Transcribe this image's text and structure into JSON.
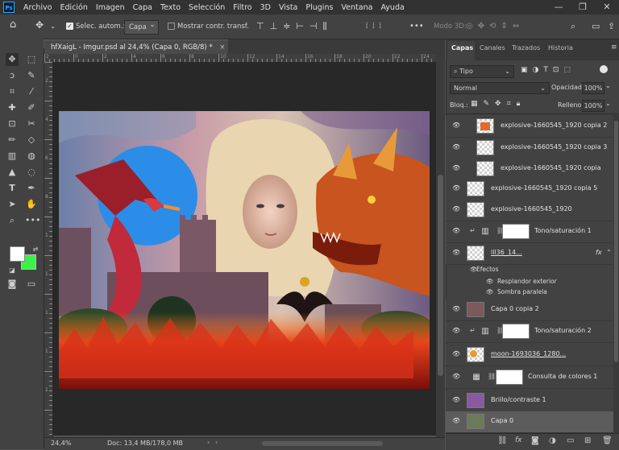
{
  "menu": [
    "Archivo",
    "Edición",
    "Imagen",
    "Capa",
    "Texto",
    "Selección",
    "Filtro",
    "3D",
    "Vista",
    "Plugins",
    "Ventana",
    "Ayuda"
  ],
  "window_controls": {
    "minimize": "—",
    "maximize": "❐",
    "close": "✕"
  },
  "options": {
    "autoselect_label": "Selec. autom.:",
    "autoselect_value": "Capa",
    "transform_label": "Mostrar contr. transf.",
    "mode3d_label": "Modo 3D:",
    "more": "•••"
  },
  "document": {
    "tab_title": "hfXaigL - Imgur.psd al 24,4% (Capa 0, RGB/8) *",
    "close": "×",
    "zoom": "24,4%",
    "doc_info": "Doc: 13,4 MB/178,0 MB"
  },
  "panel_tabs": [
    "Capas",
    "Canales",
    "Trazados",
    "Historia"
  ],
  "layers_panel": {
    "filter_label": "Tipo",
    "blend_mode": "Normal",
    "opacity_label": "Opacidad:",
    "opacity_value": "100%",
    "lock_label": "Bloq.:",
    "fill_label": "Relleno:",
    "fill_value": "100%"
  },
  "layers": [
    {
      "name": "explosive-1660545_1920 copia 2",
      "type": "explosion",
      "visible": true
    },
    {
      "name": "explosive-1660545_1920 copia 3",
      "type": "transparent",
      "visible": true
    },
    {
      "name": "explosive-1660545_1920 copia",
      "type": "transparent",
      "visible": true
    },
    {
      "name": "explosive-1660545_1920 copia 5",
      "type": "transparent",
      "visible": true
    },
    {
      "name": "explosive-1660545_1920",
      "type": "transparent",
      "visible": true
    },
    {
      "name": "Tono/saturación 1",
      "type": "adjustment",
      "visible": true
    },
    {
      "name": "lll36_14...",
      "type": "transparent",
      "visible": true,
      "fx": "fx"
    },
    {
      "name": "Capa 0 copia 2",
      "type": "photo",
      "visible": true
    },
    {
      "name": "Tono/saturación 2",
      "type": "adjustment",
      "visible": true
    },
    {
      "name": "moon-1693036_1280...",
      "type": "moon",
      "visible": true
    },
    {
      "name": "Consulta de colores 1",
      "type": "lookup",
      "visible": true
    },
    {
      "name": "Brillo/contraste 1",
      "type": "photo",
      "visible": true
    },
    {
      "name": "Capa 0",
      "type": "photo",
      "visible": true,
      "selected": true
    }
  ],
  "effects": {
    "title": "Efectos",
    "items": [
      "Resplandor exterior",
      "Sombra paralela"
    ]
  },
  "ruler_h": [
    "2",
    "0",
    "2",
    "4",
    "6",
    "8",
    "10",
    "12",
    "14",
    "16",
    "18",
    "20",
    "22",
    "24"
  ],
  "ruler_v": [
    "2",
    "4",
    "6",
    "8",
    "1",
    "1",
    "1",
    "1",
    "1"
  ],
  "colors": {
    "foreground": "#ffffff",
    "background": "#3cf04a",
    "accent": "#31a8ff"
  }
}
